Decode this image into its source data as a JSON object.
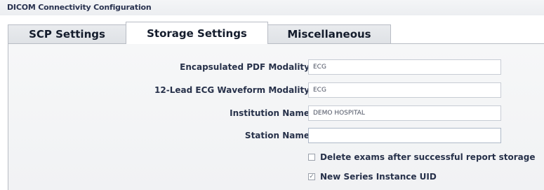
{
  "window": {
    "title": "DICOM Connectivity Configuration"
  },
  "tabs": [
    {
      "label": "SCP Settings",
      "active": false
    },
    {
      "label": "Storage Settings",
      "active": true
    },
    {
      "label": "Miscellaneous",
      "active": false
    }
  ],
  "form": {
    "fields": [
      {
        "label": "Encapsulated PDF Modality",
        "value": "ECG"
      },
      {
        "label": "12-Lead ECG Waveform Modality",
        "value": "ECG"
      },
      {
        "label": "Institution Name",
        "value": "DEMO HOSPITAL"
      },
      {
        "label": "Station Name",
        "value": ""
      }
    ],
    "checkboxes": [
      {
        "label": "Delete exams after successful report storage",
        "checked": false,
        "mark": ""
      },
      {
        "label": "New Series Instance UID",
        "checked": true,
        "mark": "✓"
      }
    ]
  },
  "colors": {
    "accent": "#27314a",
    "panel": "#f3f4f6",
    "border": "#b8bcc4"
  }
}
